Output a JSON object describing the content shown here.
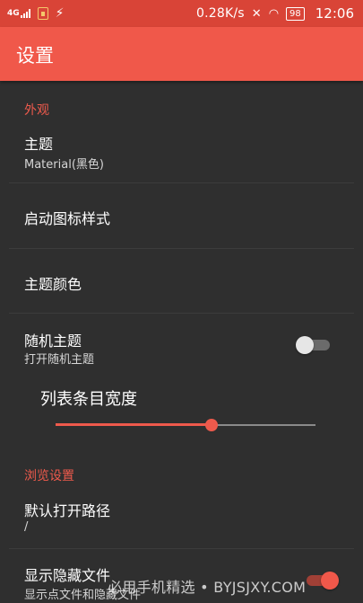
{
  "status_bar": {
    "network": "4G",
    "speed": "0.28K/s",
    "battery": "98",
    "time": "12:06"
  },
  "app_bar": {
    "title": "设置"
  },
  "sections": {
    "appearance": {
      "header": "外观",
      "theme": {
        "title": "主题",
        "subtitle": "Material(黑色)"
      },
      "launcher_icon_style": {
        "title": "启动图标样式"
      },
      "theme_color": {
        "title": "主题颜色"
      },
      "random_theme": {
        "title": "随机主题",
        "subtitle": "打开随机主题",
        "enabled": false
      },
      "list_item_width": {
        "label": "列表条目宽度",
        "value_fraction": 0.6
      }
    },
    "browse": {
      "header": "浏览设置",
      "default_path": {
        "title": "默认打开路径",
        "subtitle": "/"
      },
      "show_hidden": {
        "title": "显示隐藏文件",
        "subtitle": "显示点文件和隐藏文件",
        "enabled": true
      }
    }
  },
  "watermark": "必用手机精选 • BYJSJXY.COM",
  "colors": {
    "accent": "#f0584a",
    "status_bar": "#d94437",
    "background": "#2f2f2f"
  }
}
